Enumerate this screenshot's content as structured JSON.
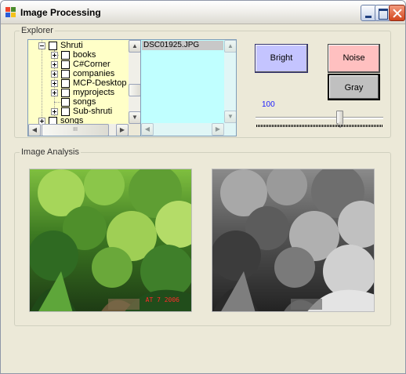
{
  "window": {
    "title": "Image Processing"
  },
  "explorer": {
    "group_label": "Explorer",
    "tree": {
      "root": "Shruti",
      "children": [
        "books",
        "C#Corner",
        "companies",
        "MCP-Desktop",
        "myprojects",
        "songs",
        "Sub-shruti"
      ],
      "next_root": "songs",
      "hscroll_mid_marker": "III"
    },
    "file_list": {
      "selected_file": "DSC01925.JPG"
    }
  },
  "controls": {
    "bright_label": "Bright",
    "noise_label": "Noise",
    "gray_label": "Gray",
    "value_label": "100",
    "slider_value_fraction": 0.65
  },
  "analysis": {
    "group_label": "Image Analysis",
    "color_image_name": "forest-photo-color",
    "gray_image_name": "forest-photo-grayscale",
    "date_stamp": "AT 7 2006"
  },
  "colors": {
    "tree_background": "#ffffc8",
    "list_background": "#c0ffff",
    "bright_button": "#c4c4ff",
    "noise_button": "#ffc0c0",
    "gray_button": "#c0c0c0",
    "value_label": "#1a1aff"
  }
}
